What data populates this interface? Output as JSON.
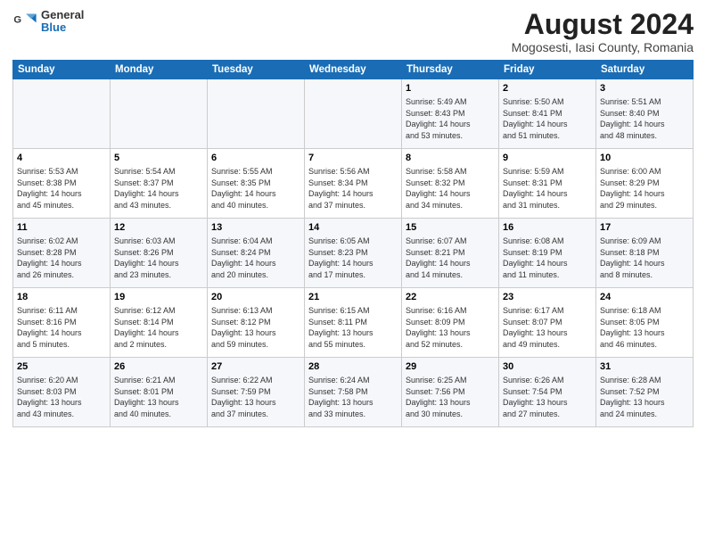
{
  "header": {
    "logo": {
      "general": "General",
      "blue": "Blue"
    },
    "title": "August 2024",
    "subtitle": "Mogosesti, Iasi County, Romania"
  },
  "weekdays": [
    "Sunday",
    "Monday",
    "Tuesday",
    "Wednesday",
    "Thursday",
    "Friday",
    "Saturday"
  ],
  "weeks": [
    [
      {
        "day": "",
        "info": ""
      },
      {
        "day": "",
        "info": ""
      },
      {
        "day": "",
        "info": ""
      },
      {
        "day": "",
        "info": ""
      },
      {
        "day": "1",
        "info": "Sunrise: 5:49 AM\nSunset: 8:43 PM\nDaylight: 14 hours\nand 53 minutes."
      },
      {
        "day": "2",
        "info": "Sunrise: 5:50 AM\nSunset: 8:41 PM\nDaylight: 14 hours\nand 51 minutes."
      },
      {
        "day": "3",
        "info": "Sunrise: 5:51 AM\nSunset: 8:40 PM\nDaylight: 14 hours\nand 48 minutes."
      }
    ],
    [
      {
        "day": "4",
        "info": "Sunrise: 5:53 AM\nSunset: 8:38 PM\nDaylight: 14 hours\nand 45 minutes."
      },
      {
        "day": "5",
        "info": "Sunrise: 5:54 AM\nSunset: 8:37 PM\nDaylight: 14 hours\nand 43 minutes."
      },
      {
        "day": "6",
        "info": "Sunrise: 5:55 AM\nSunset: 8:35 PM\nDaylight: 14 hours\nand 40 minutes."
      },
      {
        "day": "7",
        "info": "Sunrise: 5:56 AM\nSunset: 8:34 PM\nDaylight: 14 hours\nand 37 minutes."
      },
      {
        "day": "8",
        "info": "Sunrise: 5:58 AM\nSunset: 8:32 PM\nDaylight: 14 hours\nand 34 minutes."
      },
      {
        "day": "9",
        "info": "Sunrise: 5:59 AM\nSunset: 8:31 PM\nDaylight: 14 hours\nand 31 minutes."
      },
      {
        "day": "10",
        "info": "Sunrise: 6:00 AM\nSunset: 8:29 PM\nDaylight: 14 hours\nand 29 minutes."
      }
    ],
    [
      {
        "day": "11",
        "info": "Sunrise: 6:02 AM\nSunset: 8:28 PM\nDaylight: 14 hours\nand 26 minutes."
      },
      {
        "day": "12",
        "info": "Sunrise: 6:03 AM\nSunset: 8:26 PM\nDaylight: 14 hours\nand 23 minutes."
      },
      {
        "day": "13",
        "info": "Sunrise: 6:04 AM\nSunset: 8:24 PM\nDaylight: 14 hours\nand 20 minutes."
      },
      {
        "day": "14",
        "info": "Sunrise: 6:05 AM\nSunset: 8:23 PM\nDaylight: 14 hours\nand 17 minutes."
      },
      {
        "day": "15",
        "info": "Sunrise: 6:07 AM\nSunset: 8:21 PM\nDaylight: 14 hours\nand 14 minutes."
      },
      {
        "day": "16",
        "info": "Sunrise: 6:08 AM\nSunset: 8:19 PM\nDaylight: 14 hours\nand 11 minutes."
      },
      {
        "day": "17",
        "info": "Sunrise: 6:09 AM\nSunset: 8:18 PM\nDaylight: 14 hours\nand 8 minutes."
      }
    ],
    [
      {
        "day": "18",
        "info": "Sunrise: 6:11 AM\nSunset: 8:16 PM\nDaylight: 14 hours\nand 5 minutes."
      },
      {
        "day": "19",
        "info": "Sunrise: 6:12 AM\nSunset: 8:14 PM\nDaylight: 14 hours\nand 2 minutes."
      },
      {
        "day": "20",
        "info": "Sunrise: 6:13 AM\nSunset: 8:12 PM\nDaylight: 13 hours\nand 59 minutes."
      },
      {
        "day": "21",
        "info": "Sunrise: 6:15 AM\nSunset: 8:11 PM\nDaylight: 13 hours\nand 55 minutes."
      },
      {
        "day": "22",
        "info": "Sunrise: 6:16 AM\nSunset: 8:09 PM\nDaylight: 13 hours\nand 52 minutes."
      },
      {
        "day": "23",
        "info": "Sunrise: 6:17 AM\nSunset: 8:07 PM\nDaylight: 13 hours\nand 49 minutes."
      },
      {
        "day": "24",
        "info": "Sunrise: 6:18 AM\nSunset: 8:05 PM\nDaylight: 13 hours\nand 46 minutes."
      }
    ],
    [
      {
        "day": "25",
        "info": "Sunrise: 6:20 AM\nSunset: 8:03 PM\nDaylight: 13 hours\nand 43 minutes."
      },
      {
        "day": "26",
        "info": "Sunrise: 6:21 AM\nSunset: 8:01 PM\nDaylight: 13 hours\nand 40 minutes."
      },
      {
        "day": "27",
        "info": "Sunrise: 6:22 AM\nSunset: 7:59 PM\nDaylight: 13 hours\nand 37 minutes."
      },
      {
        "day": "28",
        "info": "Sunrise: 6:24 AM\nSunset: 7:58 PM\nDaylight: 13 hours\nand 33 minutes."
      },
      {
        "day": "29",
        "info": "Sunrise: 6:25 AM\nSunset: 7:56 PM\nDaylight: 13 hours\nand 30 minutes."
      },
      {
        "day": "30",
        "info": "Sunrise: 6:26 AM\nSunset: 7:54 PM\nDaylight: 13 hours\nand 27 minutes."
      },
      {
        "day": "31",
        "info": "Sunrise: 6:28 AM\nSunset: 7:52 PM\nDaylight: 13 hours\nand 24 minutes."
      }
    ]
  ]
}
